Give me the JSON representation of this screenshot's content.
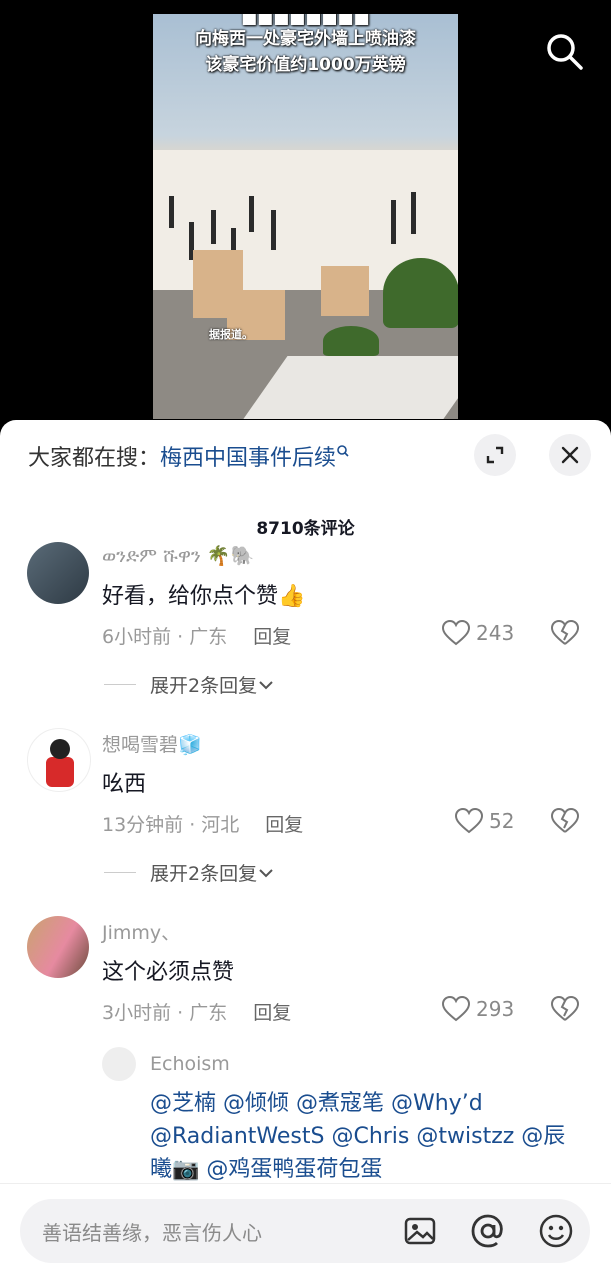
{
  "video": {
    "caption_line1": "向梅西一处豪宅外墙上喷油漆",
    "caption_line2": "该豪宅价值约1000万英镑",
    "watermark": "据报道。"
  },
  "sheet": {
    "search_hint_label": "大家都在搜：",
    "search_hint_link": "梅西中国事件后续",
    "comment_count": "8710条评论"
  },
  "comments": [
    {
      "username": "ወንድም ሹዋን 🌴🐘",
      "text": "好看，给你点个赞👍",
      "time_location": "6小时前 · 广东",
      "reply_label": "回复",
      "likes": "243",
      "expand_label": "展开2条回复"
    },
    {
      "username": "想喝雪碧🧊",
      "text": "吆西",
      "time_location": "13分钟前 · 河北",
      "reply_label": "回复",
      "likes": "52",
      "expand_label": "展开2条回复"
    },
    {
      "username": "Jimmy、",
      "text": "这个必须点赞",
      "time_location": "3小时前 · 广东",
      "reply_label": "回复",
      "likes": "293"
    }
  ],
  "sub_reply": {
    "username": "Echoism",
    "mentions": "@芝楠 @倾倾 @煮寇笔 @Why’d @RadiantWestS @Chris @twistzz @辰曦📷 @鸡蛋鸭蛋荷包蛋"
  },
  "input": {
    "placeholder": "善语结善缘，恶言伤人心"
  },
  "icons": [
    "search-icon",
    "expand-icon",
    "close-icon",
    "heart-icon",
    "broken-heart-icon",
    "chevron-down-icon",
    "image-icon",
    "at-icon",
    "emoji-icon"
  ]
}
